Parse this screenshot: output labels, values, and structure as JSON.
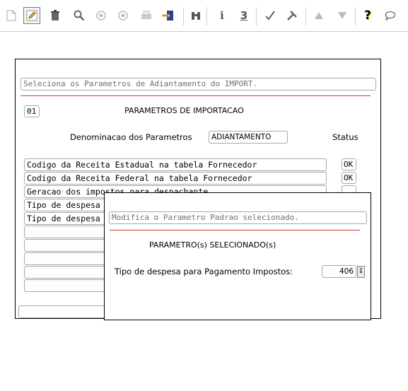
{
  "toolbar": {
    "icons": [
      "new-icon",
      "edit-icon",
      "delete-icon",
      "search-icon",
      "first-icon",
      "last-icon",
      "print-icon",
      "export-icon",
      "binoculars-icon",
      "info-icon",
      "numbered-icon",
      "confirm-icon",
      "tools-icon",
      "up-icon",
      "down-icon",
      "help-icon",
      "comment-icon"
    ],
    "info_glyph": "i",
    "num_glyph": "3",
    "help_glyph": "?"
  },
  "main": {
    "hint": "Seleciona os Parametros de Adiantamento do IMPORT.",
    "code": "01",
    "heading": "PARAMETROS DE IMPORTACAO",
    "denominacao_label": "Denominacao dos Parametros",
    "denominacao_value": "ADIANTAMENTO",
    "status_label": "Status",
    "rows": [
      {
        "label": "Codigo da Receita Estadual na tabela Fornecedor",
        "status": "OK"
      },
      {
        "label": "Codigo da Receita Federal na tabela Fornecedor",
        "status": "OK"
      },
      {
        "label": "Geracao dos impostos para despachante",
        "status": ""
      },
      {
        "label": "Tipo de despesa",
        "status": ""
      },
      {
        "label": "Tipo de despesa",
        "status": ""
      },
      {
        "label": "",
        "status": ""
      },
      {
        "label": "",
        "status": ""
      },
      {
        "label": "",
        "status": ""
      },
      {
        "label": "",
        "status": ""
      },
      {
        "label": "",
        "status": ""
      }
    ],
    "bottom_field": ""
  },
  "popup": {
    "hint": "Modifica o Parametro Padrao selecionado.",
    "heading": "PARAMETRO(s) SELECIONADO(s)",
    "field_label": "Tipo de despesa para Pagamento Impostos:",
    "field_value": "406"
  },
  "colors": {
    "rule": "#c84040",
    "border": "#a8a8a8"
  }
}
